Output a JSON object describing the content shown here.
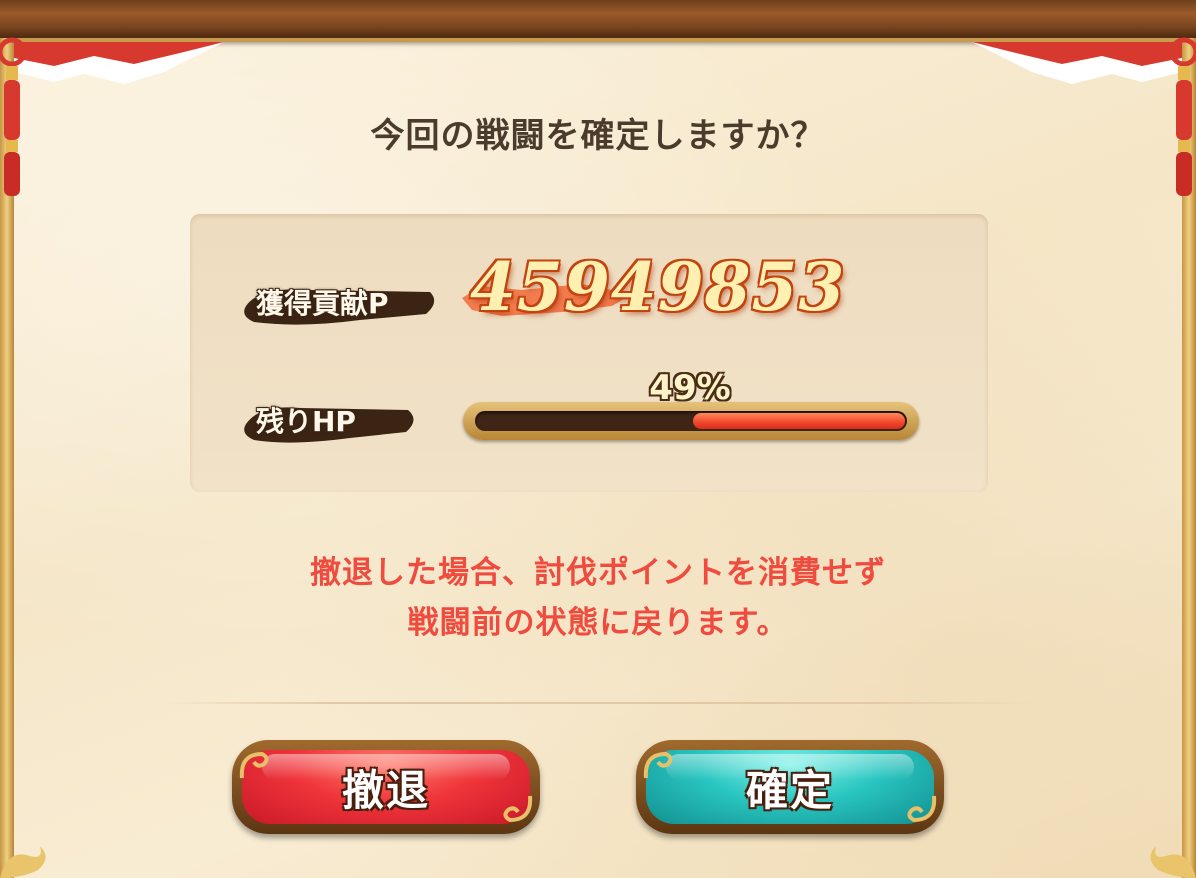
{
  "dialog": {
    "title": "今回の戦闘を確定しますか？",
    "points_label": "獲得貢献P",
    "points_value": "45949853",
    "hp_label": "残りHP",
    "hp_percent_text": "49%",
    "hp_fraction": 0.49,
    "warning_line1": "撤退した場合、討伐ポイントを消費せず",
    "warning_line2": "戦闘前の状態に戻ります。",
    "retreat_label": "撤退",
    "confirm_label": "確定"
  },
  "colors": {
    "warning_text": "#ef4b3e",
    "retreat_button": "#f0353a",
    "confirm_button": "#29c5c0",
    "hp_fill": "#f2452c"
  }
}
